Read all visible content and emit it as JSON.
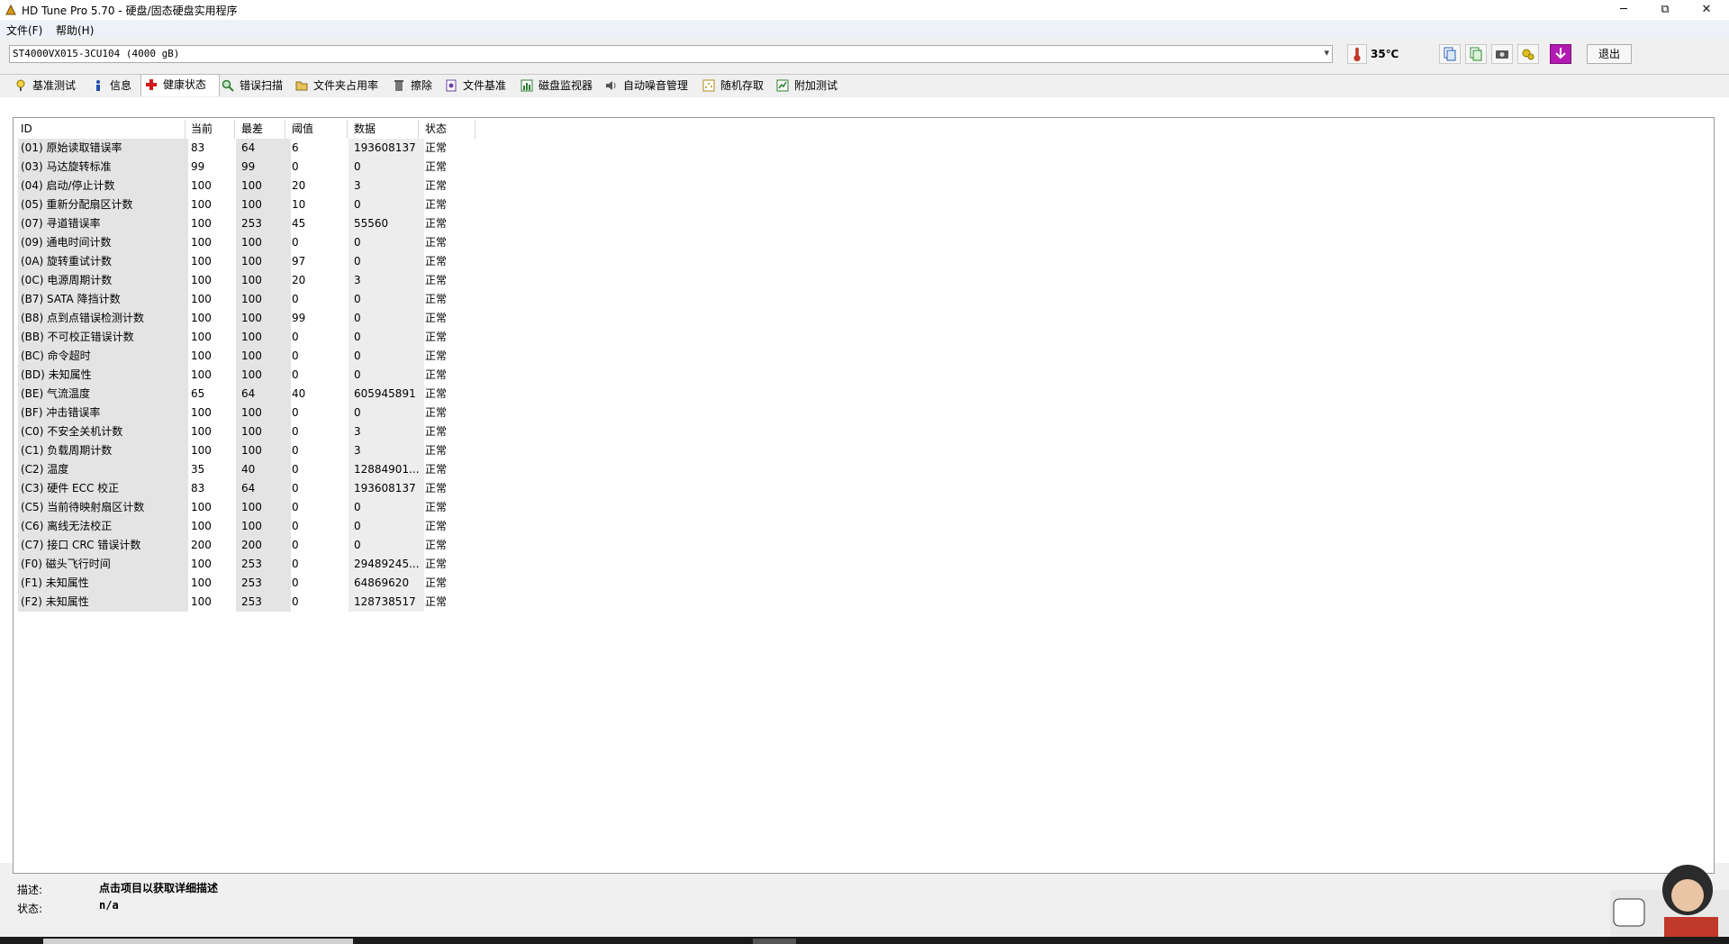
{
  "window": {
    "title": "HD Tune Pro 5.70 - 硬盘/固态硬盘实用程序",
    "controls": {
      "minimize": "─",
      "maximize": "⧉",
      "close": "✕"
    }
  },
  "menu": {
    "items": [
      "文件(F)",
      "帮助(H)"
    ]
  },
  "toolbar": {
    "drive": "ST4000VX015-3CU104 (4000 gB)",
    "temperature": "35℃",
    "exit_label": "退出",
    "buttons": [
      "copy-text-icon",
      "copy-info-icon",
      "screenshot-icon",
      "options-icon",
      "download-icon"
    ]
  },
  "tabs": [
    {
      "label": "基准测试",
      "icon": "benchmark-icon"
    },
    {
      "label": "信息",
      "icon": "info-icon"
    },
    {
      "label": "健康状态",
      "icon": "health-icon"
    },
    {
      "label": "错误扫描",
      "icon": "error-scan-icon"
    },
    {
      "label": "文件夹占用率",
      "icon": "folder-usage-icon"
    },
    {
      "label": "擦除",
      "icon": "erase-icon"
    },
    {
      "label": "文件基准",
      "icon": "file-benchmark-icon"
    },
    {
      "label": "磁盘监视器",
      "icon": "disk-monitor-icon"
    },
    {
      "label": "自动噪音管理",
      "icon": "aam-icon"
    },
    {
      "label": "随机存取",
      "icon": "random-access-icon"
    },
    {
      "label": "附加测试",
      "icon": "extra-tests-icon"
    }
  ],
  "active_tab": "健康状态",
  "table": {
    "columns": [
      "ID",
      "当前",
      "最差",
      "阈值",
      "数据",
      "状态"
    ],
    "rows": [
      [
        "(01) 原始读取错误率",
        "83",
        "64",
        "6",
        "193608137",
        "正常"
      ],
      [
        "(03) 马达旋转标准",
        "99",
        "99",
        "0",
        "0",
        "正常"
      ],
      [
        "(04) 启动/停止计数",
        "100",
        "100",
        "20",
        "3",
        "正常"
      ],
      [
        "(05) 重新分配扇区计数",
        "100",
        "100",
        "10",
        "0",
        "正常"
      ],
      [
        "(07) 寻道错误率",
        "100",
        "253",
        "45",
        "55560",
        "正常"
      ],
      [
        "(09) 通电时间计数",
        "100",
        "100",
        "0",
        "0",
        "正常"
      ],
      [
        "(0A) 旋转重试计数",
        "100",
        "100",
        "97",
        "0",
        "正常"
      ],
      [
        "(0C) 电源周期计数",
        "100",
        "100",
        "20",
        "3",
        "正常"
      ],
      [
        "(B7) SATA 降挡计数",
        "100",
        "100",
        "0",
        "0",
        "正常"
      ],
      [
        "(B8) 点到点错误检测计数",
        "100",
        "100",
        "99",
        "0",
        "正常"
      ],
      [
        "(BB) 不可校正错误计数",
        "100",
        "100",
        "0",
        "0",
        "正常"
      ],
      [
        "(BC) 命令超时",
        "100",
        "100",
        "0",
        "0",
        "正常"
      ],
      [
        "(BD) 未知属性",
        "100",
        "100",
        "0",
        "0",
        "正常"
      ],
      [
        "(BE) 气流温度",
        "65",
        "64",
        "40",
        "605945891",
        "正常"
      ],
      [
        "(BF) 冲击错误率",
        "100",
        "100",
        "0",
        "0",
        "正常"
      ],
      [
        "(C0) 不安全关机计数",
        "100",
        "100",
        "0",
        "3",
        "正常"
      ],
      [
        "(C1) 负载周期计数",
        "100",
        "100",
        "0",
        "3",
        "正常"
      ],
      [
        "(C2) 温度",
        "35",
        "40",
        "0",
        "12884901...",
        "正常"
      ],
      [
        "(C3) 硬件 ECC 校正",
        "83",
        "64",
        "0",
        "193608137",
        "正常"
      ],
      [
        "(C5) 当前待映射扇区计数",
        "100",
        "100",
        "0",
        "0",
        "正常"
      ],
      [
        "(C6) 离线无法校正",
        "100",
        "100",
        "0",
        "0",
        "正常"
      ],
      [
        "(C7) 接口 CRC 错误计数",
        "200",
        "200",
        "0",
        "0",
        "正常"
      ],
      [
        "(F0) 磁头飞行时间",
        "100",
        "253",
        "0",
        "29489245...",
        "正常"
      ],
      [
        "(F1) 未知属性",
        "100",
        "253",
        "0",
        "64869620",
        "正常"
      ],
      [
        "(F2) 未知属性",
        "100",
        "253",
        "0",
        "128738517",
        "正常"
      ]
    ]
  },
  "footer": {
    "description_label": "描述:",
    "description_value": "点击项目以获取详细描述",
    "status_label": "状态:",
    "status_value": "n/a"
  }
}
